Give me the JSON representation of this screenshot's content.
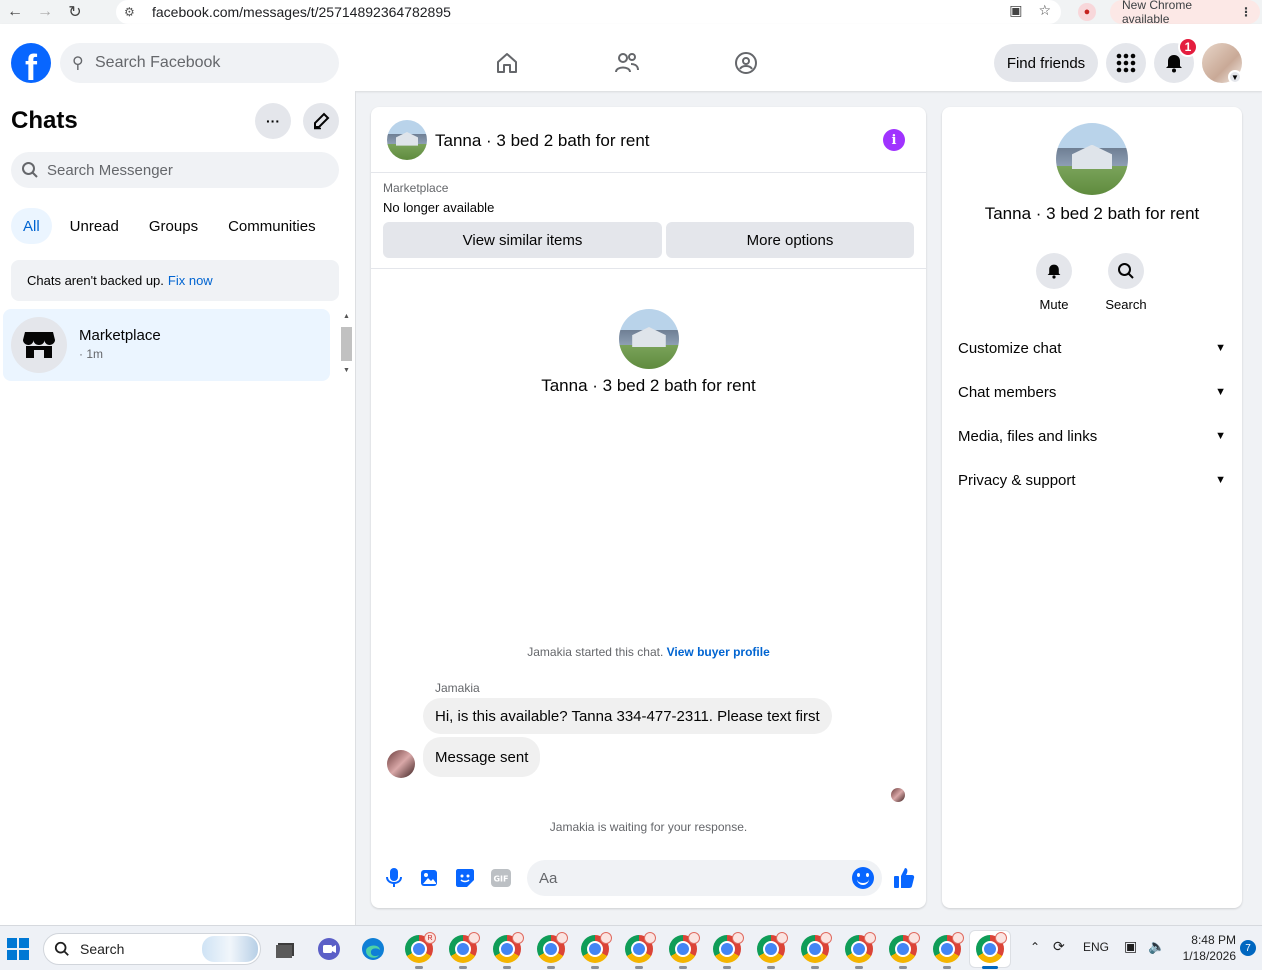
{
  "browser": {
    "url": "facebook.com/messages/t/25714892364782895",
    "update_label": "New Chrome available"
  },
  "header": {
    "logo_letter": "f",
    "search_placeholder": "Search Facebook",
    "find_friends_label": "Find friends",
    "notification_count": "1"
  },
  "sidebar": {
    "title": "Chats",
    "search_placeholder": "Search Messenger",
    "filters": [
      "All",
      "Unread",
      "Groups",
      "Communities"
    ],
    "active_filter": "All",
    "backup_text": "Chats aren't backed up.",
    "backup_link": "Fix now",
    "chats": [
      {
        "name": "Marketplace",
        "time": "· 1m"
      }
    ]
  },
  "conversation": {
    "title": "Tanna · 3 bed 2 bath for rent",
    "marketplace_label": "Marketplace",
    "listing_status": "No longer available",
    "view_similar_label": "View similar items",
    "more_options_label": "More options",
    "started_text": "Jamakia started this chat.",
    "buyer_profile_link": "View buyer profile",
    "sender_name": "Jamakia",
    "messages": [
      "Hi, is this available? Tanna 334-477-2311. Please text first",
      "Message sent"
    ],
    "waiting_text": "Jamakia is waiting for your response.",
    "composer_placeholder": "Aa"
  },
  "info_panel": {
    "title": "Tanna · 3 bed 2 bath for rent",
    "mute_label": "Mute",
    "search_label": "Search",
    "sections": [
      "Customize chat",
      "Chat members",
      "Media, files and links",
      "Privacy & support"
    ]
  },
  "taskbar": {
    "search_placeholder": "Search",
    "language": "ENG",
    "time": "8:48 PM",
    "date": "1/18/2026",
    "notification_count": "7"
  },
  "colors": {
    "brand": "#0866ff",
    "accent_text": "#0064d1",
    "info_icon": "#a033ff",
    "badge": "#e41e3f"
  }
}
